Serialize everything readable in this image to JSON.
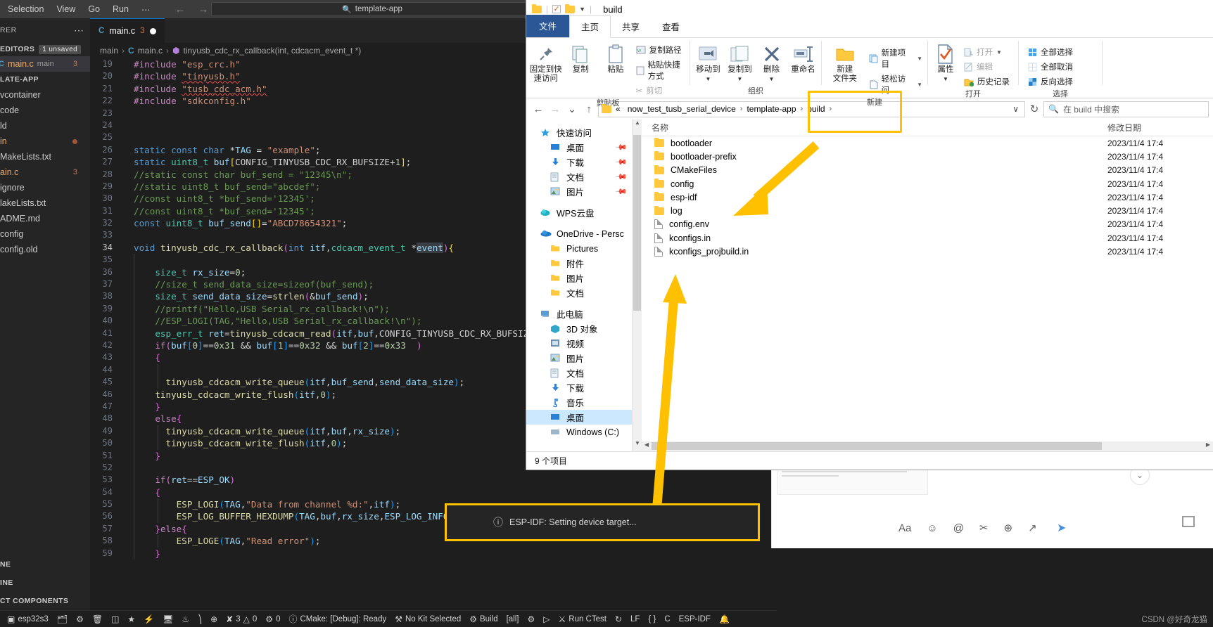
{
  "vscode": {
    "menu": [
      "Selection",
      "View",
      "Go",
      "Run",
      "⋯"
    ],
    "nav": {
      "back": "←",
      "forward": "→"
    },
    "search": {
      "icon": "search-icon",
      "value": "template-app"
    },
    "sidebar": {
      "title": "RER",
      "more": "⋯",
      "open_editors_label": "EDITORS",
      "unsaved_badge": "1 unsaved",
      "open_editor": {
        "lang": "C",
        "name": "main.c",
        "folder": "main",
        "count": "3"
      },
      "project_label": "LATE-APP",
      "items": [
        {
          "label": "vcontainer",
          "badge": ""
        },
        {
          "label": "code",
          "badge": ""
        },
        {
          "label": "ld",
          "badge": ""
        },
        {
          "label": "in",
          "badge": "dot"
        },
        {
          "label": "MakeLists.txt",
          "badge": ""
        },
        {
          "label": "ain.c",
          "badge": "3",
          "modified": true
        },
        {
          "label": "ignore",
          "badge": ""
        },
        {
          "label": "lakeLists.txt",
          "badge": ""
        },
        {
          "label": "ADME.md",
          "badge": ""
        },
        {
          "label": "config",
          "badge": ""
        },
        {
          "label": "config.old",
          "badge": ""
        }
      ],
      "bottom_sections": [
        "NE",
        "INE",
        "CT COMPONENTS"
      ]
    },
    "tab": {
      "lang": "C",
      "name": "main.c",
      "count": "3",
      "dirty": true
    },
    "breadcrumb": {
      "root": "main",
      "lang": "C",
      "file": "main.c",
      "symbol": "tinyusb_cdc_rx_callback(int, cdcacm_event_t *)"
    },
    "code_start_line": 19,
    "code_lines": [
      "#include \"esp_crc.h\"",
      "#include \"tinyusb.h\"",
      "#include \"tusb_cdc_acm.h\"",
      "#include \"sdkconfig.h\"",
      "",
      "",
      "static const char *TAG = \"example\";",
      "static uint8_t buf[CONFIG_TINYUSB_CDC_RX_BUFSIZE+1];",
      "//static const char buf_send = \"12345\\n\";",
      "//static uint8_t buf_send=\"abcdef\";",
      "//const uint8_t *buf_send='12345';",
      "//const uint8_t *buf_send='12345';",
      "const uint8_t buf_send[]=\"ABCD78654321\";",
      "",
      "void tinyusb_cdc_rx_callback(int itf,cdcacm_event_t *event){",
      "",
      "    size_t rx_size=0;",
      "    //size_t send_data_size=sizeof(buf_send);",
      "    size_t send_data_size=strlen(&buf_send);",
      "    //printf(\"Hello,USB Serial_rx_callback!\\n\");",
      "    //ESP_LOGI(TAG,\"Hello,USB Serial_rx_callback!\\n\");",
      "    esp_err_t ret=tinyusb_cdcacm_read(itf,buf,CONFIG_TINYUSB_CDC_RX_BUFSIZE,&rx_",
      "    if(buf[0]==0x31 && buf[1]==0x32 && buf[2]==0x33  )",
      "    {",
      "",
      "      tinyusb_cdcacm_write_queue(itf,buf_send,send_data_size);",
      "    tinyusb_cdcacm_write_flush(itf,0);",
      "    }",
      "    else{",
      "      tinyusb_cdcacm_write_queue(itf,buf,rx_size);",
      "      tinyusb_cdcacm_write_flush(itf,0);",
      "    }",
      "",
      "    if(ret==ESP_OK)",
      "    {",
      "        ESP_LOGI(TAG,\"Data from channel %d:\",itf);",
      "        ESP_LOG_BUFFER_HEXDUMP(TAG,buf,rx_size,ESP_LOG_INFO);",
      "    }else{",
      "        ESP_LOGE(TAG,\"Read error\");",
      "    }",
      "}"
    ],
    "status_bar": [
      {
        "icon": "chip-icon",
        "label": "esp32s3"
      },
      {
        "icon": "folder-icon",
        "label": ""
      },
      {
        "icon": "gear-icon",
        "label": ""
      },
      {
        "icon": "trash-icon",
        "label": ""
      },
      {
        "icon": "device-icon",
        "label": ""
      },
      {
        "icon": "star-icon",
        "label": ""
      },
      {
        "icon": "flash-icon",
        "label": ""
      },
      {
        "icon": "monitor-icon",
        "label": ""
      },
      {
        "icon": "flame-icon",
        "label": ""
      },
      {
        "icon": "terminal-icon",
        "label": ""
      },
      {
        "icon": "login-icon",
        "label": ""
      },
      {
        "icon": "error-icon",
        "label": "3"
      },
      {
        "icon": "warning-icon",
        "label": "0"
      },
      {
        "icon": "ports-icon",
        "label": "0"
      },
      {
        "icon": "info-icon",
        "label": "CMake: [Debug]: Ready"
      },
      {
        "icon": "tools-icon",
        "label": "No Kit Selected"
      },
      {
        "icon": "gear-icon",
        "label": "Build"
      },
      {
        "icon": "",
        "label": "[all]"
      },
      {
        "icon": "bug-icon",
        "label": ""
      },
      {
        "icon": "play-icon",
        "label": ""
      },
      {
        "icon": "beaker-icon",
        "label": "Run CTest"
      },
      {
        "icon": "refresh-icon",
        "label": ""
      },
      {
        "icon": "",
        "label": "LF"
      },
      {
        "icon": "",
        "label": "{ }"
      },
      {
        "icon": "",
        "label": "C"
      },
      {
        "icon": "",
        "label": "ESP-IDF"
      },
      {
        "icon": "bell-icon",
        "label": ""
      }
    ],
    "notification": {
      "icon": "info-icon",
      "text": "ESP-IDF: Setting device target..."
    }
  },
  "explorer": {
    "window_title": "build",
    "titlebar_icons": [
      "folder-icon",
      "checkbox-icon",
      "folder-icon",
      "chevron-down-icon"
    ],
    "tabs": [
      {
        "label": "文件",
        "kind": "file"
      },
      {
        "label": "主页",
        "kind": "active"
      },
      {
        "label": "共享",
        "kind": "normal"
      },
      {
        "label": "查看",
        "kind": "normal"
      }
    ],
    "ribbon": {
      "groups": [
        {
          "label": "剪贴板",
          "big": [
            {
              "icon": "pin-icon",
              "label": "固定到快\n速访问"
            },
            {
              "icon": "copy-icon",
              "label": "复制"
            },
            {
              "icon": "paste-icon",
              "label": "粘贴"
            }
          ],
          "small": [
            {
              "icon": "copy-path-icon",
              "label": "复制路径"
            },
            {
              "icon": "paste-shortcut-icon",
              "label": "粘贴快捷方式"
            },
            {
              "icon": "scissors-icon",
              "label": "剪切"
            }
          ]
        },
        {
          "label": "组织",
          "big": [
            {
              "icon": "move-to-icon",
              "label": "移动到"
            },
            {
              "icon": "copy-to-icon",
              "label": "复制到"
            },
            {
              "icon": "delete-icon",
              "label": "删除"
            },
            {
              "icon": "rename-icon",
              "label": "重命名"
            }
          ],
          "small": []
        },
        {
          "label": "新建",
          "big": [
            {
              "icon": "new-folder-icon",
              "label": "新建\n文件夹"
            }
          ],
          "small": [
            {
              "icon": "new-item-icon",
              "label": "新建项目"
            },
            {
              "icon": "easy-access-icon",
              "label": "轻松访问"
            }
          ]
        },
        {
          "label": "打开",
          "big": [
            {
              "icon": "properties-icon",
              "label": "属性"
            }
          ],
          "small": [
            {
              "icon": "open-icon",
              "label": "打开"
            },
            {
              "icon": "edit-icon",
              "label": "编辑"
            },
            {
              "icon": "history-icon",
              "label": "历史记录"
            }
          ]
        },
        {
          "label": "选择",
          "big": [],
          "small": [
            {
              "icon": "select-all-icon",
              "label": "全部选择"
            },
            {
              "icon": "select-none-icon",
              "label": "全部取消"
            },
            {
              "icon": "invert-selection-icon",
              "label": "反向选择"
            }
          ]
        }
      ]
    },
    "address": {
      "back": "←",
      "forward": "→",
      "up": "↑",
      "breadcrumbs": [
        "«",
        "now_test_tusb_serial_device",
        "template-app",
        "build"
      ],
      "dropdown": "∨",
      "refresh": "↻",
      "search_placeholder": "在 build 中搜索",
      "search_icon": "search-icon"
    },
    "nav_pane": [
      {
        "icon": "star-icon",
        "label": "快速访问",
        "indent": 0,
        "pin": false,
        "gap_before": false
      },
      {
        "icon": "desktop-icon",
        "label": "桌面",
        "indent": 1,
        "pin": true,
        "gap_before": false
      },
      {
        "icon": "download-icon",
        "label": "下载",
        "indent": 1,
        "pin": true,
        "gap_before": false
      },
      {
        "icon": "docs-icon",
        "label": "文档",
        "indent": 1,
        "pin": true,
        "gap_before": false
      },
      {
        "icon": "pictures-icon",
        "label": "图片",
        "indent": 1,
        "pin": true,
        "gap_before": false
      },
      {
        "icon": "wps-cloud-icon",
        "label": "WPS云盘",
        "indent": 0,
        "pin": false,
        "gap_before": true
      },
      {
        "icon": "onedrive-icon",
        "label": "OneDrive - Persc",
        "indent": 0,
        "pin": false,
        "gap_before": true
      },
      {
        "icon": "folder-icon",
        "label": "Pictures",
        "indent": 1,
        "pin": false,
        "gap_before": false
      },
      {
        "icon": "folder-icon",
        "label": "附件",
        "indent": 1,
        "pin": false,
        "gap_before": false
      },
      {
        "icon": "folder-icon",
        "label": "图片",
        "indent": 1,
        "pin": false,
        "gap_before": false
      },
      {
        "icon": "folder-icon",
        "label": "文档",
        "indent": 1,
        "pin": false,
        "gap_before": false
      },
      {
        "icon": "pc-icon",
        "label": "此电脑",
        "indent": 0,
        "pin": false,
        "gap_before": true
      },
      {
        "icon": "3d-objects-icon",
        "label": "3D 对象",
        "indent": 1,
        "pin": false,
        "gap_before": false
      },
      {
        "icon": "video-icon",
        "label": "视频",
        "indent": 1,
        "pin": false,
        "gap_before": false
      },
      {
        "icon": "pictures-icon",
        "label": "图片",
        "indent": 1,
        "pin": false,
        "gap_before": false
      },
      {
        "icon": "docs-icon",
        "label": "文档",
        "indent": 1,
        "pin": false,
        "gap_before": false
      },
      {
        "icon": "download-icon",
        "label": "下载",
        "indent": 1,
        "pin": false,
        "gap_before": false
      },
      {
        "icon": "music-icon",
        "label": "音乐",
        "indent": 1,
        "pin": false,
        "gap_before": false
      },
      {
        "icon": "desktop-icon",
        "label": "桌面",
        "indent": 1,
        "pin": false,
        "gap_before": false,
        "selected": true
      },
      {
        "icon": "disk-icon",
        "label": "Windows (C:)",
        "indent": 1,
        "pin": false,
        "gap_before": false
      }
    ],
    "columns": {
      "name": "名称",
      "date": "修改日期"
    },
    "files": [
      {
        "type": "folder",
        "name": "bootloader",
        "date": "2023/11/4 17:4"
      },
      {
        "type": "folder",
        "name": "bootloader-prefix",
        "date": "2023/11/4 17:4"
      },
      {
        "type": "folder",
        "name": "CMakeFiles",
        "date": "2023/11/4 17:4"
      },
      {
        "type": "folder",
        "name": "config",
        "date": "2023/11/4 17:4"
      },
      {
        "type": "folder",
        "name": "esp-idf",
        "date": "2023/11/4 17:4"
      },
      {
        "type": "folder",
        "name": "log",
        "date": "2023/11/4 17:4"
      },
      {
        "type": "file",
        "name": "config.env",
        "date": "2023/11/4 17:4"
      },
      {
        "type": "file",
        "name": "kconfigs.in",
        "date": "2023/11/4 17:4"
      },
      {
        "type": "file",
        "name": "kconfigs_projbuild.in",
        "date": "2023/11/4 17:4"
      }
    ],
    "status": "9 个项目"
  },
  "watermark": "CSDN @好奇龙猫"
}
